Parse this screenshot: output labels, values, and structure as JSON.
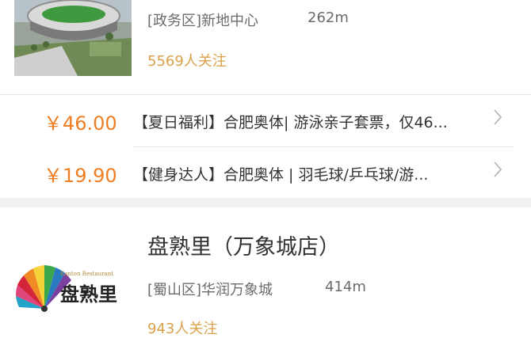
{
  "shops": [
    {
      "district": "[政务区]新地中心",
      "distance": "262m",
      "followers": "5569人关注",
      "image_icon": "stadium-thumbnail",
      "deals": [
        {
          "price": "￥46.00",
          "text": "【夏日福利】合肥奥体| 游泳亲子套票，仅46...",
          "arrow": "chevron-right-icon"
        },
        {
          "price": "￥19.90",
          "text": "【健身达人】合肥奥体 | 羽毛球/乒乓球/游...",
          "arrow": "chevron-right-icon"
        }
      ]
    },
    {
      "title": "盘熟里（万象城店）",
      "district": "[蜀山区]华润万象城",
      "distance": "414m",
      "followers": "943人关注",
      "image_icon": "restaurant-logo",
      "logo_text": "盘熟里",
      "logo_small_text": "Kanton Restaurant"
    }
  ],
  "colors": {
    "price": "#ef7d22",
    "followers": "#d9a14a",
    "separator": "#f2f2f2"
  }
}
